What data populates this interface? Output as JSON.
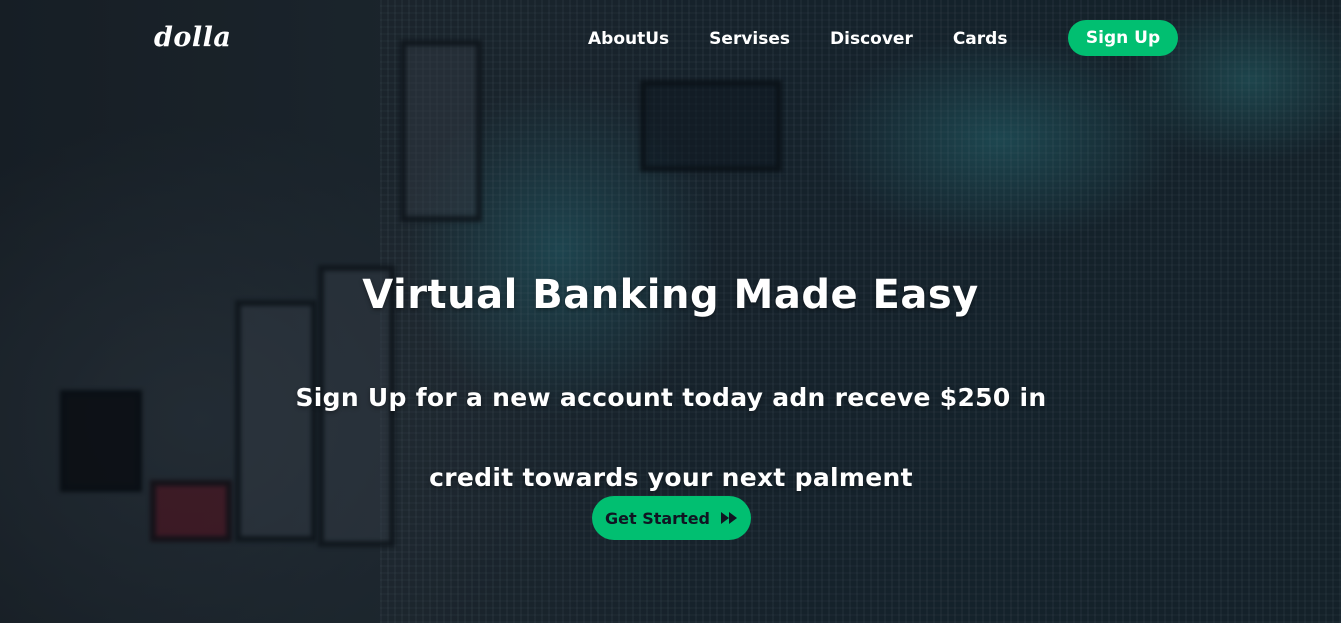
{
  "brand": {
    "logo": "dolla"
  },
  "nav": {
    "links": [
      "AboutUs",
      "Servises",
      "Discover",
      "Cards"
    ],
    "signup_label": "Sign Up"
  },
  "hero": {
    "title": "Virtual Banking Made Easy",
    "subtitle": "Sign Up for a new account today adn receve $250 in credit towards your next palment",
    "cta_label": "Get Started",
    "cta_icon": "fast-forward-icon"
  },
  "colors": {
    "accent": "#01bf71",
    "text": "#ffffff",
    "cta_text": "#101522"
  }
}
